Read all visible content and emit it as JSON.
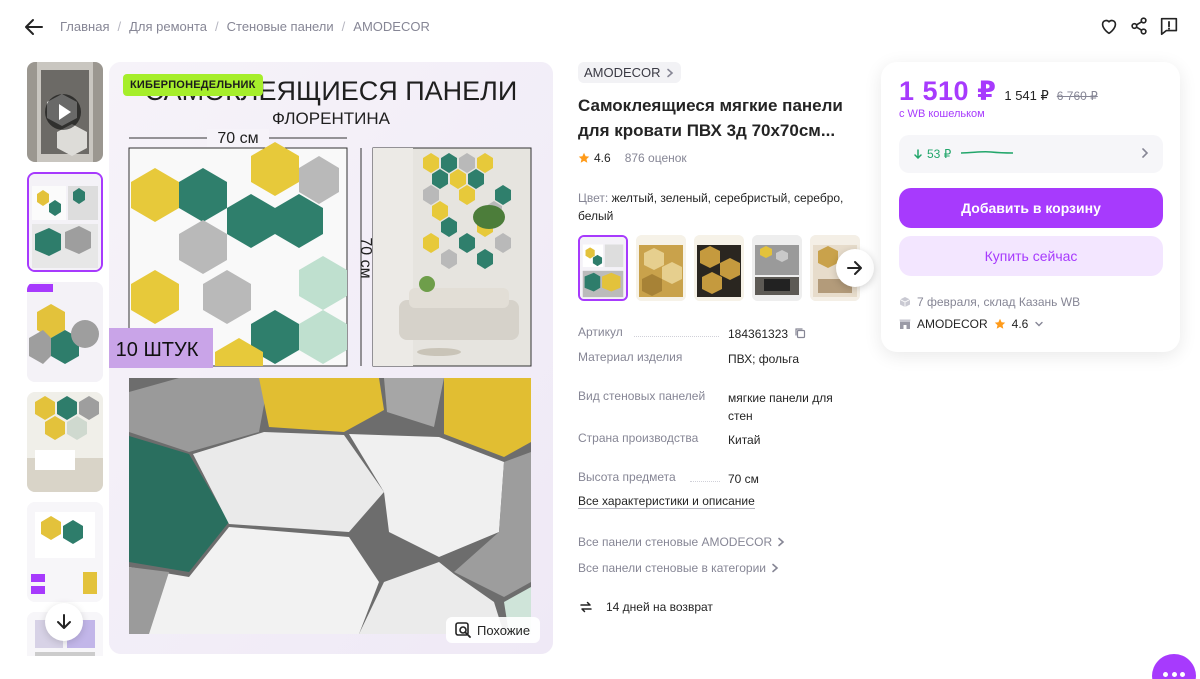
{
  "breadcrumb": [
    "Главная",
    "Для ремонта",
    "Стеновые панели",
    "AMODECOR"
  ],
  "main_image": {
    "badge": "КИБЕРПОНЕДЕЛЬНИК",
    "headline": "САМОКЛЕЯЩИЕСЯ ПАНЕЛИ",
    "subheadline": "ФЛОРЕНТИНА",
    "width_label": "70 см",
    "height_label": "70 см",
    "count_label": "10 ШТУК",
    "similar_label": "Похожие"
  },
  "product": {
    "brand": "AMODECOR",
    "title": "Самоклеящиеся мягкие панели для кровати ПВХ 3д 70х70см...",
    "rating": "4.6",
    "reviews": "876 оценок",
    "color_label": "Цвет:",
    "color_value": "желтый, зеленый, серебристый, серебро, белый"
  },
  "specs": [
    {
      "key": "Артикул",
      "value": "184361323"
    },
    {
      "key": "Материал изделия",
      "value": "ПВХ; фольга"
    },
    {
      "key": "Вид стеновых панелей",
      "value": "мягкие панели для стен"
    },
    {
      "key": "Страна производства",
      "value": "Китай"
    },
    {
      "key": "Высота предмета",
      "value": "70 см"
    }
  ],
  "links": {
    "all_specs": "Все характеристики и описание",
    "brand_panels": "Все панели стеновые AMODECOR",
    "category_panels": "Все панели стеновые в категории",
    "returns": "14 дней на возврат"
  },
  "buybox": {
    "price": "1 510 ₽",
    "price_regular": "1 541 ₽",
    "price_old": "6 760 ₽",
    "wallet_note": "с WB кошельком",
    "price_drop": "53 ₽",
    "add_to_cart": "Добавить в корзину",
    "buy_now": "Купить сейчас",
    "delivery": "7 февраля, склад Казань WB",
    "seller": "AMODECOR",
    "seller_rating": "4.6"
  },
  "colors": {
    "accent": "#a73afd",
    "accent_light": "#f3e6ff",
    "promo": "#a6ee2b",
    "green_status": "#22a66b",
    "muted_text": "#868695"
  },
  "icons": [
    "back-arrow-icon",
    "heart-icon",
    "share-icon",
    "report-icon",
    "play-icon",
    "arrow-down-icon",
    "arrow-right-icon",
    "search-image-icon",
    "chevron-right-icon",
    "star-icon",
    "copy-icon",
    "return-icon",
    "box-icon",
    "shop-icon",
    "chat-icon"
  ]
}
